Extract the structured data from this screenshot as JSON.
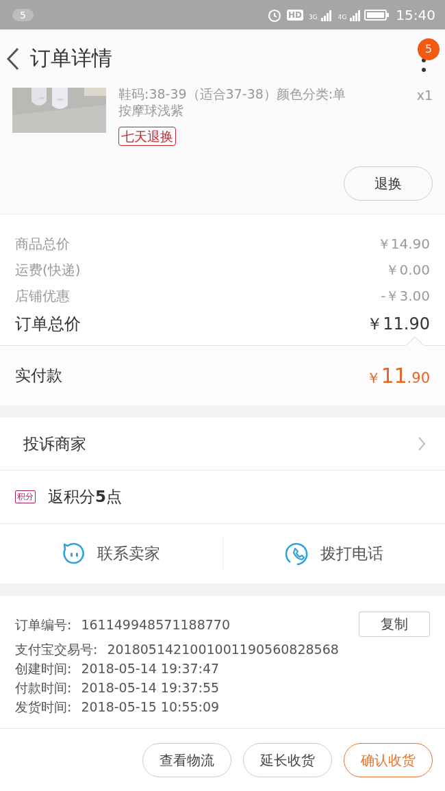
{
  "status_bar": {
    "notification_count": "5",
    "hd": "HD",
    "net1": "3G",
    "net2": "4G",
    "time": "15:40"
  },
  "header": {
    "title": "订单详情",
    "badge": "5"
  },
  "product": {
    "kind": "picture",
    "spec_lines": [
      "鞋码:38-39（适合37-38）颜色分类:单",
      "按摩球浅紫"
    ],
    "quantity": "x1",
    "tag": "七天退换",
    "action": "退换"
  },
  "price_rows": [
    {
      "kind": "item",
      "label": "商品总价",
      "value": "￥14.90"
    },
    {
      "kind": "item",
      "label": "运费(快递)",
      "value": "￥0.00"
    },
    {
      "kind": "item",
      "label": "店铺优惠",
      "value": "-￥3.00"
    },
    {
      "kind": "total",
      "label": "订单总价",
      "value": "￥11.90"
    }
  ],
  "paid": {
    "label": "实付款",
    "currency": "￥",
    "whole": "11",
    "fraction": ".90"
  },
  "complaint": {
    "label": "投诉商家"
  },
  "points": {
    "badge": "积分",
    "text": "返积分**5**点"
  },
  "contact": [
    {
      "kind": "chat",
      "label": "联系卖家"
    },
    {
      "kind": "phone",
      "label": "拨打电话"
    }
  ],
  "order_info": [
    {
      "label": "订单编号:",
      "value": "161149948571188770"
    },
    {
      "label": "支付宝交易号:",
      "value": "2018051421001001190560828568"
    },
    {
      "label": "创建时间:",
      "value": "2018-05-14 19:37:47"
    },
    {
      "label": "付款时间:",
      "value": "2018-05-14 19:37:55"
    },
    {
      "label": "发货时间:",
      "value": "2018-05-15 10:55:09"
    }
  ],
  "copy_button": "复制",
  "actions": [
    {
      "label": "查看物流",
      "primary": false
    },
    {
      "label": "延长收货",
      "primary": false
    },
    {
      "label": "确认收货",
      "primary": true
    }
  ]
}
